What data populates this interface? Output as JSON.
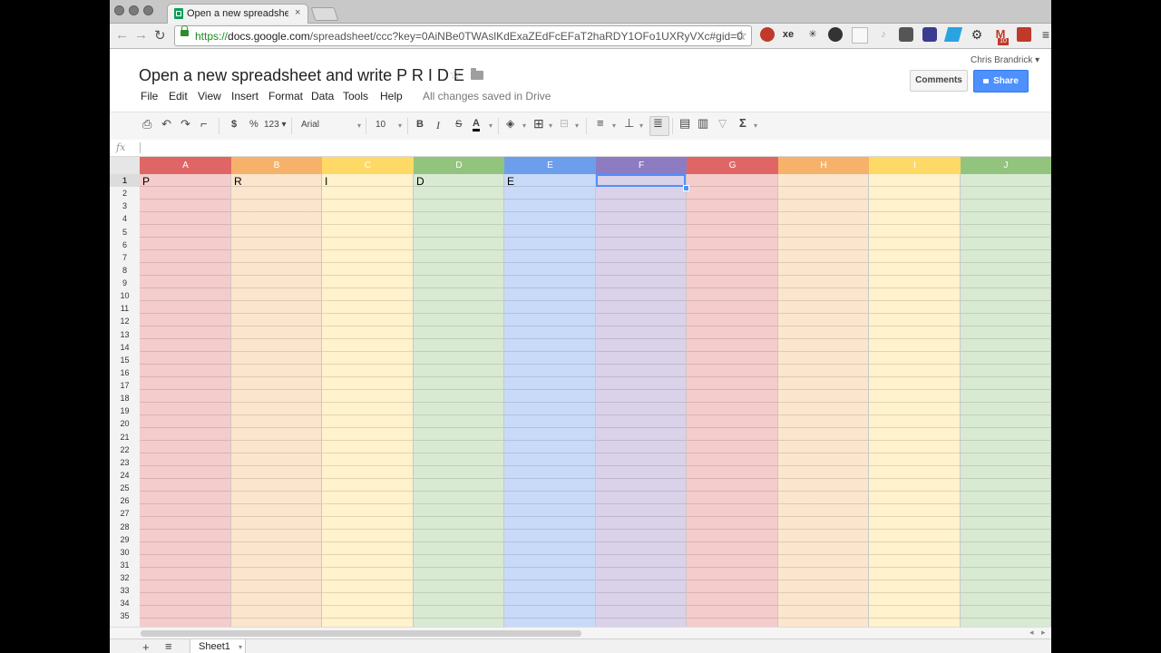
{
  "browser": {
    "tab_title": "Open a new spreadsheet a",
    "tab_close": "×",
    "url_scheme": "https://",
    "url_host": "docs.google.com",
    "url_path": "/spreadsheet/ccc?key=0AiNBe0TWAslKdExaZEdFcEFaT2haRDY1OFo1UXRyVXc#gid=0",
    "back": "←",
    "forward": "→",
    "reload": "↻",
    "star": "☆",
    "extensions": [
      "xe",
      "10"
    ]
  },
  "doc": {
    "title": "Open a new spreadsheet and write P R I D E",
    "star": "☆",
    "menus": [
      "File",
      "Edit",
      "View",
      "Insert",
      "Format",
      "Data",
      "Tools",
      "Help"
    ],
    "saved_status": "All changes saved in Drive",
    "user_name": "Chris Brandrick ▾",
    "comments_label": "Comments",
    "share_label": "Share"
  },
  "edit_toolbar": {
    "currency": "$",
    "percent": "%",
    "number_format": "123 ▾",
    "font": "Arial",
    "font_size": "10",
    "bold": "B",
    "italic": "I",
    "strike": "S",
    "text_color": "A",
    "sum": "Σ",
    "dropdown": "▾"
  },
  "formula_bar": {
    "fx_label": "fx",
    "value": ""
  },
  "grid": {
    "columns": [
      {
        "label": "A",
        "header_color": "#e06666",
        "fill": "#f4cccc"
      },
      {
        "label": "B",
        "header_color": "#f6b26b",
        "fill": "#fce5cd"
      },
      {
        "label": "C",
        "header_color": "#ffd966",
        "fill": "#fff2cc"
      },
      {
        "label": "D",
        "header_color": "#93c47d",
        "fill": "#d9ead3"
      },
      {
        "label": "E",
        "header_color": "#6d9eeb",
        "fill": "#c9daf8"
      },
      {
        "label": "F",
        "header_color": "#8e7cc3",
        "fill": "#d9d2e9"
      },
      {
        "label": "G",
        "header_color": "#e06666",
        "fill": "#f4cccc"
      },
      {
        "label": "H",
        "header_color": "#f6b26b",
        "fill": "#fce5cd"
      },
      {
        "label": "I",
        "header_color": "#ffd966",
        "fill": "#fff2cc"
      },
      {
        "label": "J",
        "header_color": "#93c47d",
        "fill": "#d9ead3"
      }
    ],
    "row1_values": [
      "P",
      "R",
      "I",
      "D",
      "E",
      "",
      "",
      "",
      "",
      ""
    ],
    "row_numbers": [
      "1",
      "2",
      "3",
      "4",
      "5",
      "6",
      "7",
      "8",
      "9",
      "10",
      "11",
      "12",
      "13",
      "14",
      "15",
      "16",
      "17",
      "18",
      "19",
      "20",
      "21",
      "22",
      "23",
      "24",
      "25",
      "26",
      "27",
      "28",
      "29",
      "30",
      "31",
      "32",
      "33",
      "34",
      "35"
    ],
    "selected_cell": "F1"
  },
  "sheets": {
    "add": "+",
    "list_icon": "≡",
    "tabs": [
      "Sheet1"
    ],
    "tab_menu": "▾"
  }
}
